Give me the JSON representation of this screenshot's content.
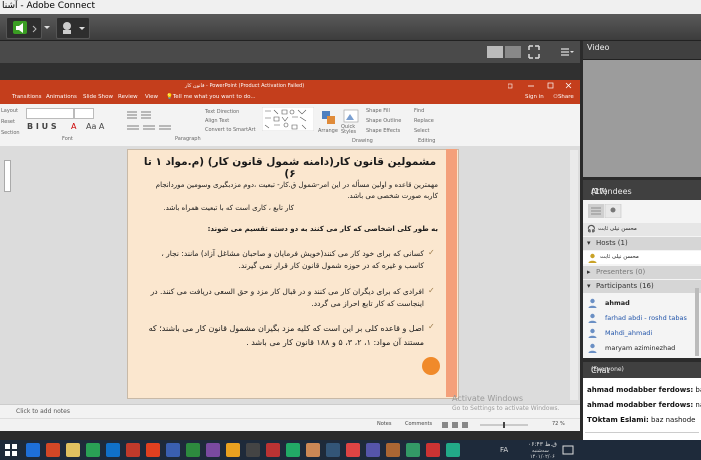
{
  "window": {
    "title": "آشنا - Adobe Connect"
  },
  "toolbar": {
    "speaker_icon": "speaker-icon",
    "camera_icon": "webcam-icon"
  },
  "share_pod": {
    "menu_icon": "menu-icon"
  },
  "powerpoint": {
    "title": "قانون کار - PowerPoint (Product Activation Failed)",
    "tabs": [
      "Transitions",
      "Animations",
      "Slide Show",
      "Review",
      "View"
    ],
    "tell_me": "Tell me what you want to do...",
    "sign_in": "Sign in",
    "share": "Share",
    "ribbon_left": [
      "Layout",
      "Reset",
      "Section"
    ],
    "ribbon_groups": [
      "Font",
      "Paragraph",
      "Drawing",
      "Editing"
    ],
    "ribbon_labels": {
      "text_direction": "Text Direction",
      "align_text": "Align Text",
      "convert_smartart": "Convert to SmartArt",
      "arrange": "Arrange",
      "quick_styles": "Quick Styles",
      "shape_fill": "Shape Fill",
      "shape_outline": "Shape Outline",
      "shape_effects": "Shape Effects",
      "find": "Find",
      "replace": "Replace",
      "select": "Select"
    },
    "notes_placeholder": "Click to add notes",
    "status_notes": "Notes",
    "status_comments": "Comments",
    "zoom": "72 %"
  },
  "slide": {
    "title": "مشمولین قانون کار(دامنه شمول قانون کار) (م.مواد ۱ تا ۶)",
    "para1": "مهمترین قاعده و اولین مسأله در این امر-شمول ق.کار- تبعیت ،دوم مزدبگیری وسومین موردانجام کاربه صورت شخصی می باشد.",
    "para1b": "کار تابع ، کاری است که با تبعیت همراه باشد.",
    "bold_line": "به طور کلی اشخاصی که کار می کنند به دو دسته تقسیم می شوند:",
    "bullet1": "کسانی که برای خود کار می کنند(خویش فرمایان و صاحبان مشاغل آزاد) مانند: نجار ، کاسب و غیره که در حوزه شمول قانون کار قرار نمی گیرند.",
    "bullet2": "افرادی که برای دیگران کار می کنند و در قبال کار مزد و حق السعی دریافت می کنند. در اینجاست که کار تابع احراز می گردد.",
    "bullet3": "اصل و قاعده کلی بر این است که کلیه مزد بگیران مشمول قانون کار می باشند؛ که مستند آن مواد: ۱، ۲، ۳، ۵ و ۱۸۸ قانون کار می باشد ."
  },
  "watermark": {
    "line1": "Activate Windows",
    "line2": "Go to Settings to activate Windows."
  },
  "video_pod": {
    "title": "Video"
  },
  "attendees_pod": {
    "title": "Attendees",
    "count": "(17)",
    "presenter_name": "محسن نیلی ثابت",
    "hosts_label": "Hosts (1)",
    "host_name": "محسن نیلی ثابت",
    "presenters_label": "Presenters (0)",
    "participants_label": "Participants (16)",
    "participants": [
      {
        "name": "ahmad",
        "color": "#222222",
        "bold": true
      },
      {
        "name": "farhad abdi - roshd tabas",
        "color": "#2255aa",
        "bold": false
      },
      {
        "name": "Mahdi_ahmadi",
        "color": "#2255aa",
        "bold": false
      },
      {
        "name": "maryam aziminezhad",
        "color": "#222222",
        "bold": false
      }
    ]
  },
  "chat_pod": {
    "title": "Chat",
    "scope": "(Everyone)",
    "messages": [
      "ahmad modabber ferdows: bale",
      "ahmad modabber ferdows: na",
      "TOktam Eslami: baz nashode"
    ]
  },
  "taskbar": {
    "time": "ق.ظ ۰۶:۴۳",
    "day": "سه‌شنبه",
    "date": "۱۴۰۱/۰۲/۰۶",
    "lang": "FA"
  },
  "colors": {
    "ppt_red": "#c43e1c",
    "slide_bg": "#fbe7cf",
    "orange_dot": "#f08a2a"
  }
}
